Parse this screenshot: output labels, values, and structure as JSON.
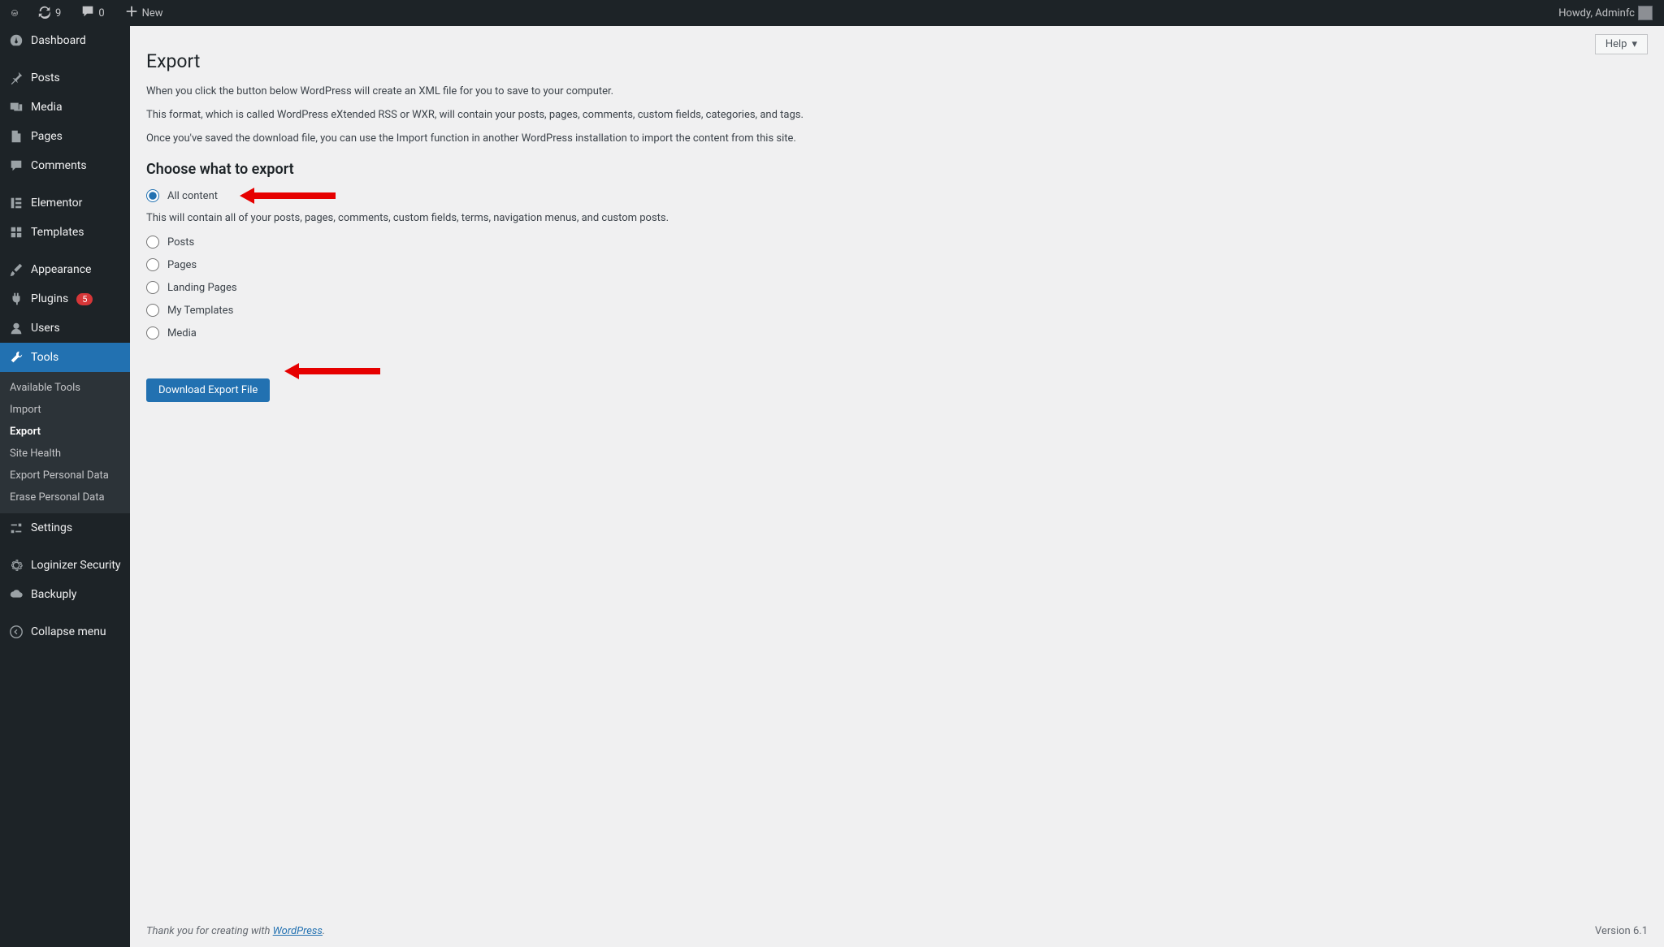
{
  "adminbar": {
    "updates_count": "9",
    "comments_count": "0",
    "new_label": "New",
    "greeting": "Howdy, Adminfc"
  },
  "sidebar": {
    "dashboard": "Dashboard",
    "posts": "Posts",
    "media": "Media",
    "pages": "Pages",
    "comments": "Comments",
    "elementor": "Elementor",
    "templates": "Templates",
    "appearance": "Appearance",
    "plugins": "Plugins",
    "plugins_badge": "5",
    "users": "Users",
    "tools": "Tools",
    "tools_sub": {
      "available": "Available Tools",
      "import": "Import",
      "export": "Export",
      "site_health": "Site Health",
      "export_pd": "Export Personal Data",
      "erase_pd": "Erase Personal Data"
    },
    "settings": "Settings",
    "loginizer": "Loginizer Security",
    "backuply": "Backuply",
    "collapse": "Collapse menu"
  },
  "content": {
    "help": "Help",
    "title": "Export",
    "p1": "When you click the button below WordPress will create an XML file for you to save to your computer.",
    "p2": "This format, which is called WordPress eXtended RSS or WXR, will contain your posts, pages, comments, custom fields, categories, and tags.",
    "p3": "Once you've saved the download file, you can use the Import function in another WordPress installation to import the content from this site.",
    "h2": "Choose what to export",
    "options": {
      "all": "All content",
      "all_hint": "This will contain all of your posts, pages, comments, custom fields, terms, navigation menus, and custom posts.",
      "posts": "Posts",
      "pages": "Pages",
      "landing": "Landing Pages",
      "mytemplates": "My Templates",
      "media": "Media"
    },
    "button": "Download Export File"
  },
  "footer": {
    "prefix": "Thank you for creating with ",
    "link": "WordPress",
    "suffix": ".",
    "version": "Version 6.1"
  }
}
